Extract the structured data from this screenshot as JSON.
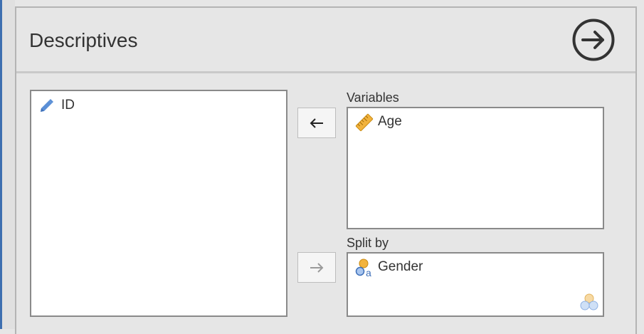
{
  "panel": {
    "title": "Descriptives"
  },
  "source_list": {
    "items": [
      {
        "label": "ID",
        "icon": "id-pencil-icon"
      }
    ]
  },
  "variables": {
    "label": "Variables",
    "items": [
      {
        "label": "Age",
        "icon": "continuous-ruler-icon"
      }
    ]
  },
  "split_by": {
    "label": "Split by",
    "items": [
      {
        "label": "Gender",
        "icon": "nominal-text-icon"
      }
    ]
  },
  "colors": {
    "accent_blue": "#3e6fb0",
    "ruler_orange": "#f2b33d",
    "nominal_blue": "#5b8fd6"
  }
}
